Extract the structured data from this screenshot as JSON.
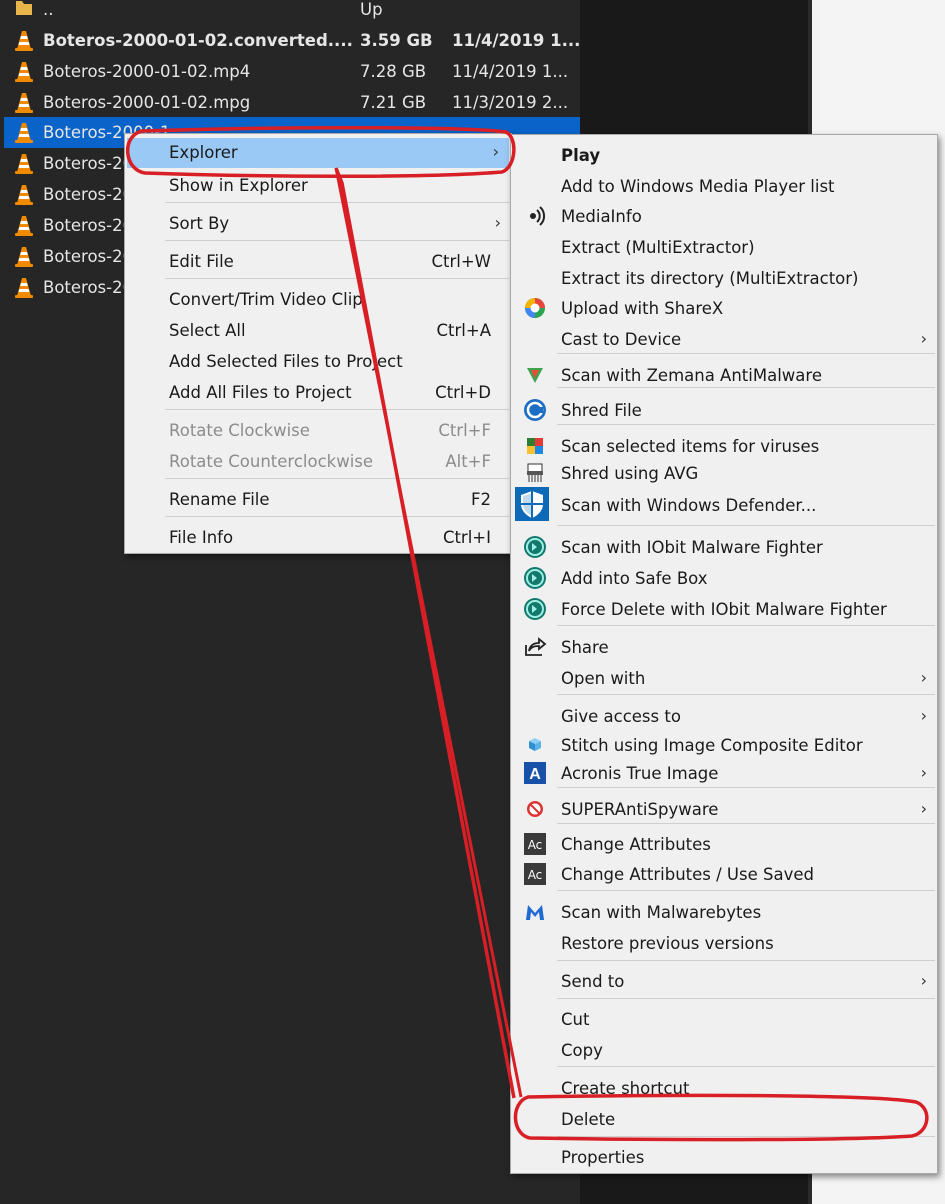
{
  "files": [
    {
      "name": "..",
      "size": "Up",
      "date": "",
      "type": "folder",
      "bold": false,
      "selected": false
    },
    {
      "name": "Boteros-2000-01-02.converted....",
      "size": "3.59 GB",
      "date": "11/4/2019 1...",
      "type": "vlc",
      "bold": true,
      "selected": false
    },
    {
      "name": "Boteros-2000-01-02.mp4",
      "size": "7.28 GB",
      "date": "11/4/2019 1...",
      "type": "vlc",
      "bold": false,
      "selected": false
    },
    {
      "name": "Boteros-2000-01-02.mpg",
      "size": "7.21 GB",
      "date": "11/3/2019 2...",
      "type": "vlc",
      "bold": false,
      "selected": false
    },
    {
      "name": "Boteros-2000-1",
      "size": "",
      "date": "",
      "type": "vlc",
      "bold": false,
      "selected": true
    },
    {
      "name": "Boteros-20",
      "size": "",
      "date": "",
      "type": "vlc",
      "bold": false,
      "selected": false
    },
    {
      "name": "Boteros-20",
      "size": "",
      "date": "",
      "type": "vlc",
      "bold": false,
      "selected": false
    },
    {
      "name": "Boteros-20",
      "size": "",
      "date": "",
      "type": "vlc",
      "bold": false,
      "selected": false
    },
    {
      "name": "Boteros-20",
      "size": "",
      "date": "",
      "type": "vlc",
      "bold": false,
      "selected": false
    },
    {
      "name": "Boteros-20",
      "size": "",
      "date": "",
      "type": "vlc",
      "bold": false,
      "selected": false
    }
  ],
  "app_menu": {
    "items": [
      {
        "label": "Explorer",
        "shortcut": "",
        "submenu": true,
        "disabled": false,
        "highlighted": true
      },
      {
        "label": "Show in Explorer",
        "shortcut": "",
        "submenu": false,
        "disabled": false
      },
      {
        "label": "Sort By",
        "shortcut": "",
        "submenu": true,
        "disabled": false
      },
      {
        "label": "Edit File",
        "shortcut": "Ctrl+W",
        "submenu": false,
        "disabled": false
      },
      {
        "label": "Convert/Trim Video Clip",
        "shortcut": "",
        "submenu": false,
        "disabled": false
      },
      {
        "label": "Select All",
        "shortcut": "Ctrl+A",
        "submenu": false,
        "disabled": false
      },
      {
        "label": "Add Selected Files to Project",
        "shortcut": "",
        "submenu": false,
        "disabled": false
      },
      {
        "label": "Add All Files to Project",
        "shortcut": "Ctrl+D",
        "submenu": false,
        "disabled": false
      },
      {
        "label": "Rotate Clockwise",
        "shortcut": "Ctrl+F",
        "submenu": false,
        "disabled": true
      },
      {
        "label": "Rotate Counterclockwise",
        "shortcut": "Alt+F",
        "submenu": false,
        "disabled": true
      },
      {
        "label": "Rename File",
        "shortcut": "F2",
        "submenu": false,
        "disabled": false
      },
      {
        "label": "File Info",
        "shortcut": "Ctrl+I",
        "submenu": false,
        "disabled": false
      }
    ]
  },
  "explorer_menu": {
    "items": [
      {
        "label": "Play",
        "icon": "",
        "submenu": false,
        "bold": true
      },
      {
        "label": "Add to Windows Media Player list",
        "icon": "",
        "submenu": false
      },
      {
        "label": "MediaInfo",
        "icon": "mediainfo-icon",
        "submenu": false
      },
      {
        "label": "Extract (MultiExtractor)",
        "icon": "",
        "submenu": false
      },
      {
        "label": "Extract its directory (MultiExtractor)",
        "icon": "",
        "submenu": false
      },
      {
        "label": "Upload with ShareX",
        "icon": "sharex-icon",
        "submenu": false
      },
      {
        "label": "Cast to Device",
        "icon": "",
        "submenu": true
      },
      {
        "label": "Scan with Zemana AntiMalware",
        "icon": "zemana-icon",
        "submenu": false
      },
      {
        "label": "Shred File",
        "icon": "shred-icon",
        "submenu": false
      },
      {
        "label": "Scan selected items for viruses",
        "icon": "avg-icon",
        "submenu": false
      },
      {
        "label": "Shred using AVG",
        "icon": "shredder-icon",
        "submenu": false
      },
      {
        "label": "Scan with Windows Defender...",
        "icon": "defender-shield-icon",
        "submenu": false
      },
      {
        "label": "Scan with IObit Malware Fighter",
        "icon": "iobit-icon",
        "submenu": false
      },
      {
        "label": "Add into Safe Box",
        "icon": "iobit-icon",
        "submenu": false
      },
      {
        "label": "Force Delete with IObit Malware Fighter",
        "icon": "iobit-icon",
        "submenu": false
      },
      {
        "label": "Share",
        "icon": "share-icon",
        "submenu": false
      },
      {
        "label": "Open with",
        "icon": "",
        "submenu": true
      },
      {
        "label": "Give access to",
        "icon": "",
        "submenu": true
      },
      {
        "label": "Stitch using Image Composite Editor",
        "icon": "ice-cube-icon",
        "submenu": false
      },
      {
        "label": "Acronis True Image",
        "icon": "acronis-icon",
        "submenu": true
      },
      {
        "label": "SUPERAntiSpyware",
        "icon": "superantispyware-icon",
        "submenu": true
      },
      {
        "label": "Change Attributes",
        "icon": "attributes-icon",
        "submenu": false
      },
      {
        "label": "Change Attributes / Use Saved",
        "icon": "attributes-icon",
        "submenu": false
      },
      {
        "label": "Scan with Malwarebytes",
        "icon": "malwarebytes-icon",
        "submenu": false
      },
      {
        "label": "Restore previous versions",
        "icon": "",
        "submenu": false
      },
      {
        "label": "Send to",
        "icon": "",
        "submenu": true
      },
      {
        "label": "Cut",
        "icon": "",
        "submenu": false
      },
      {
        "label": "Copy",
        "icon": "",
        "submenu": false
      },
      {
        "label": "Create shortcut",
        "icon": "",
        "submenu": false
      },
      {
        "label": "Delete",
        "icon": "",
        "submenu": false
      },
      {
        "label": "Properties",
        "icon": "",
        "submenu": false
      }
    ]
  },
  "glyphs": {
    "submenu_arrow": "›",
    "attributes_text": "Ac",
    "acronis_letter": "A"
  },
  "colors": {
    "annotation": "#d91f26",
    "selection": "#0a63c9",
    "highlight": "#99c9f4"
  }
}
